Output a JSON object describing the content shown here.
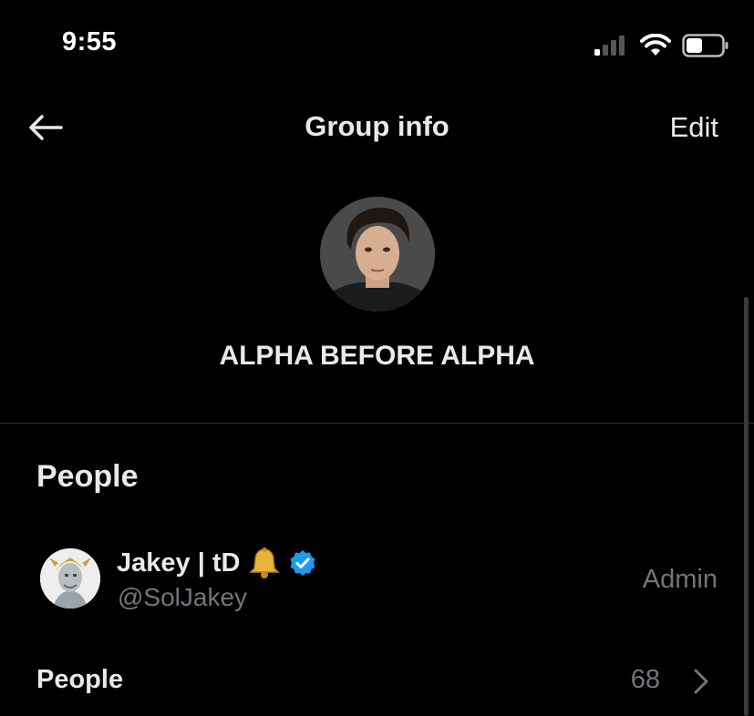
{
  "status_bar": {
    "time": "9:55"
  },
  "header": {
    "title": "Group info",
    "edit_label": "Edit"
  },
  "group": {
    "name": "ALPHA BEFORE ALPHA"
  },
  "people_section": {
    "title": "People",
    "members": [
      {
        "display_name": "Jakey | tD",
        "handle": "@SolJakey",
        "role": "Admin"
      }
    ],
    "people_row": {
      "label": "People",
      "count": "68"
    }
  },
  "colors": {
    "background": "#000000",
    "text": "#e7e9ea",
    "secondary": "#71767b",
    "verified": "#1d9bf0",
    "divider": "#2f3336"
  }
}
